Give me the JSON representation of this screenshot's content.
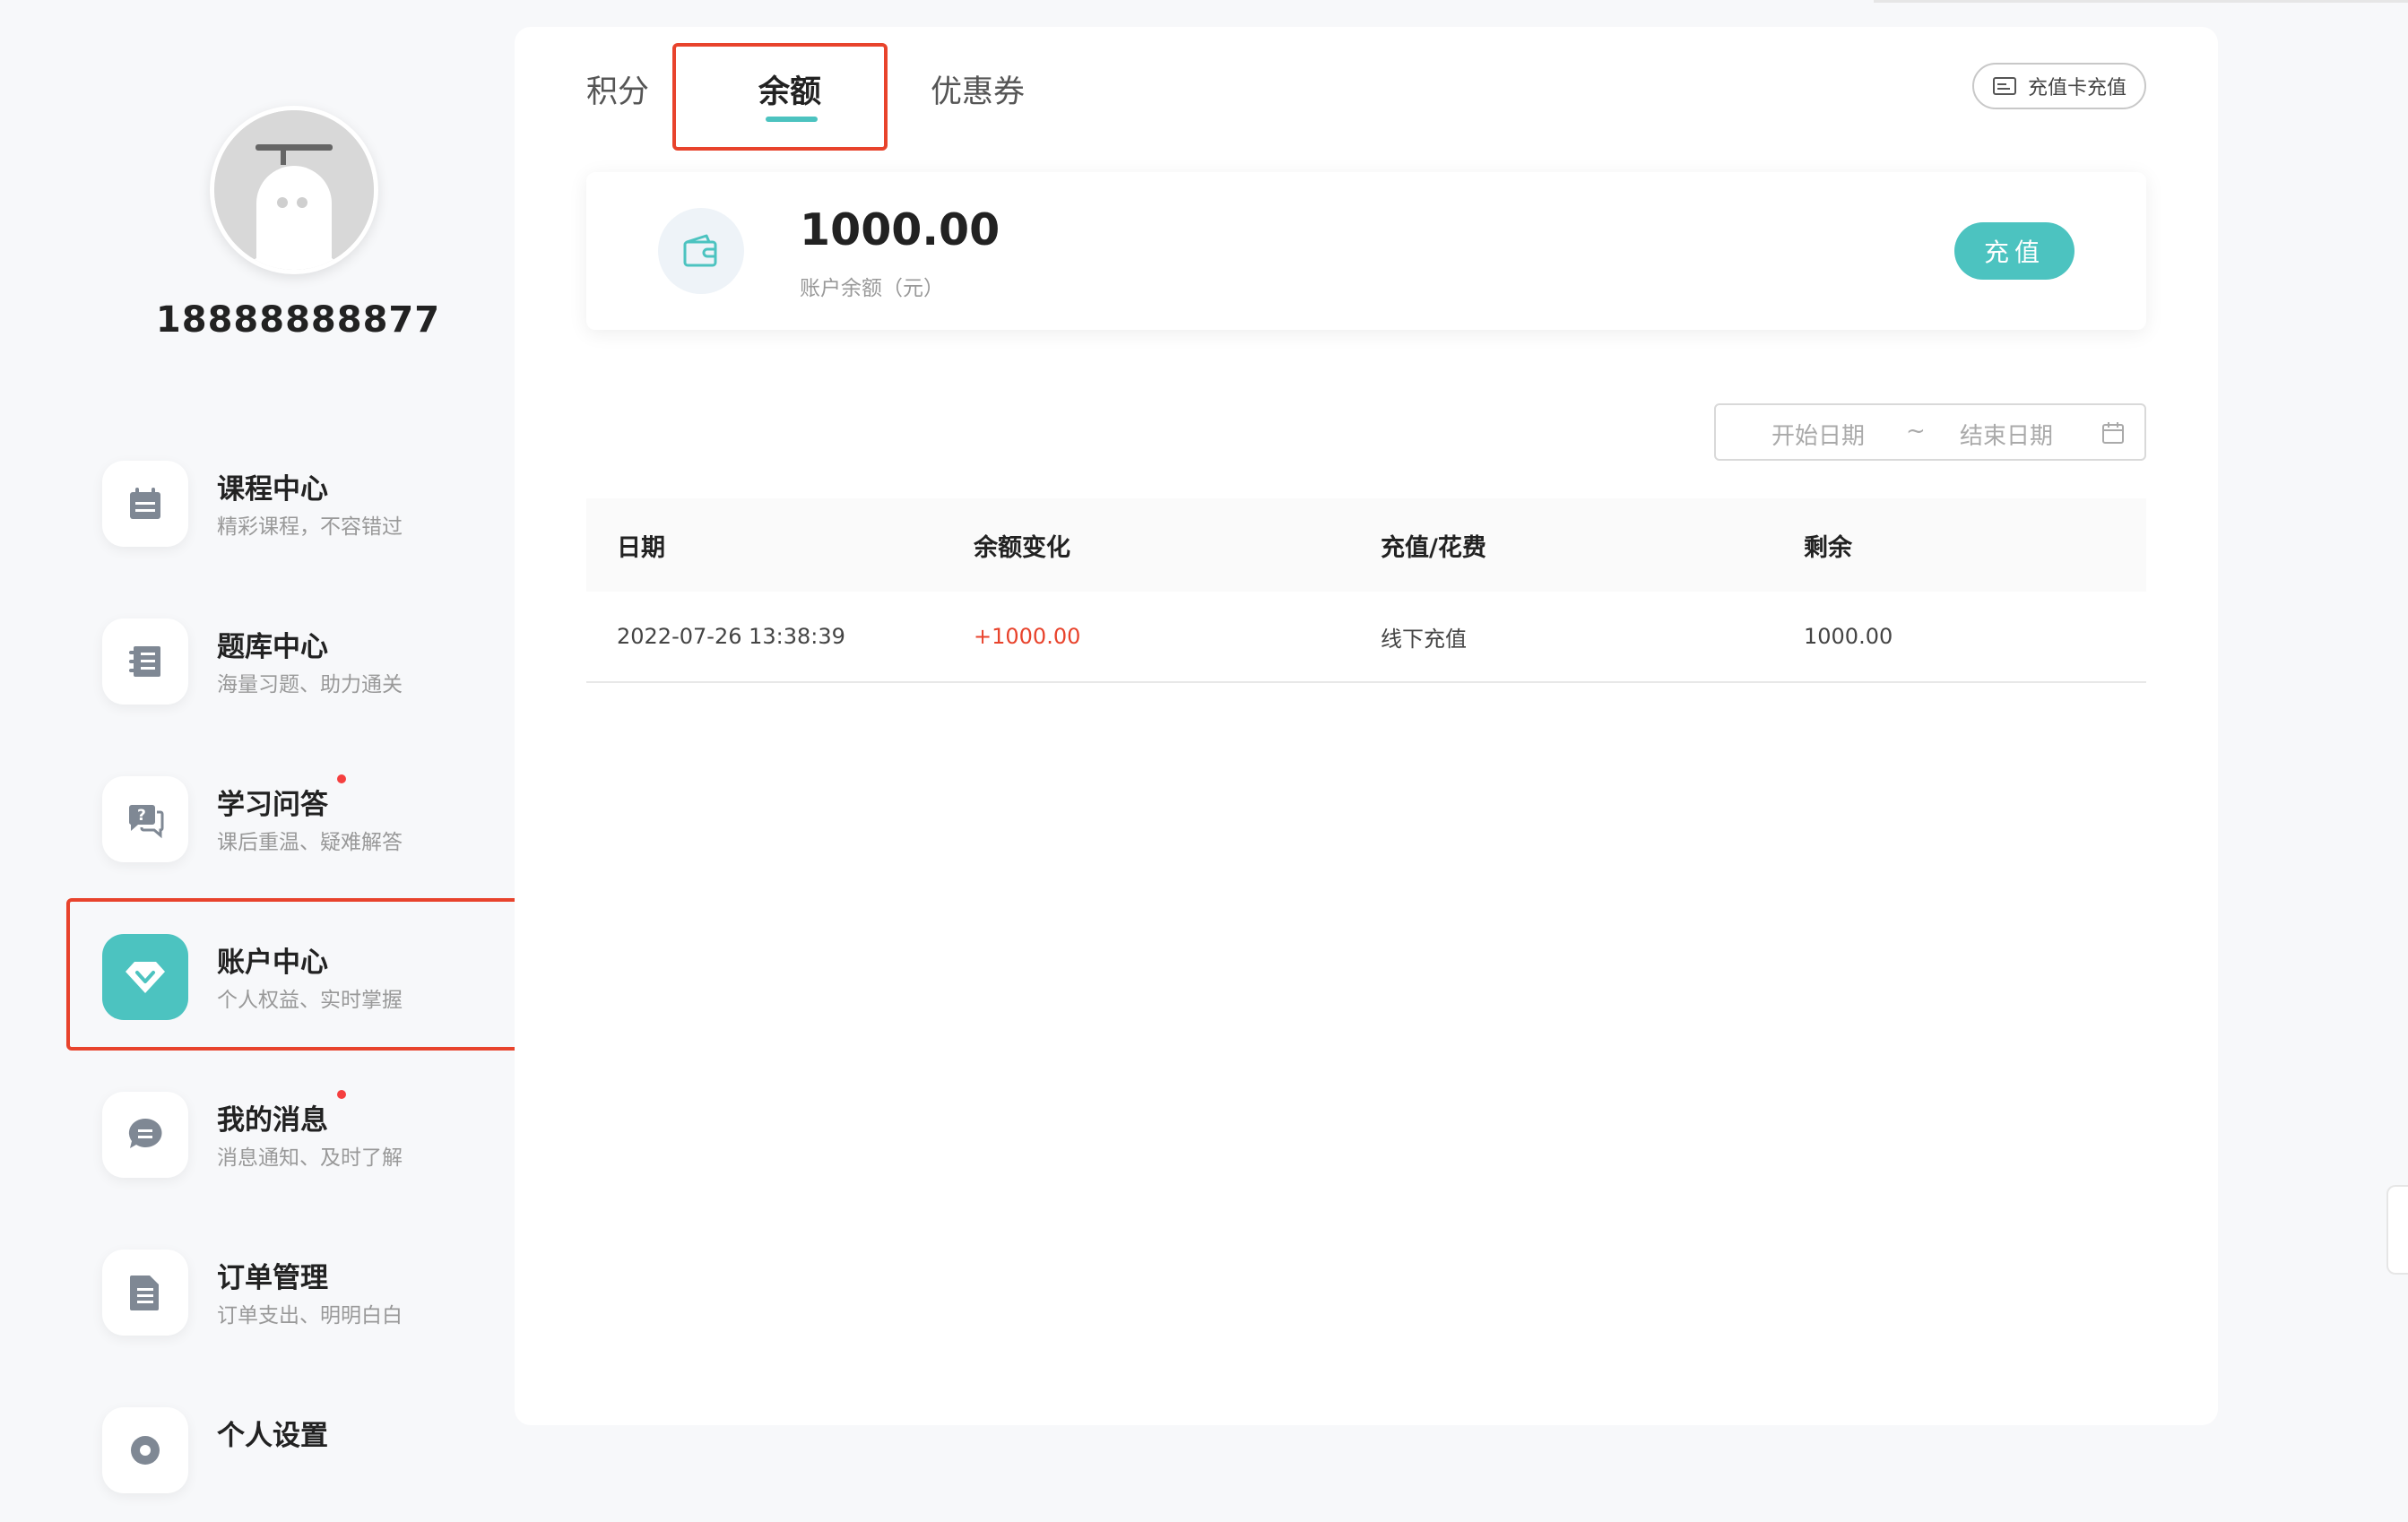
{
  "user": {
    "phone": "18888888877"
  },
  "sidebar": {
    "items": [
      {
        "id": "course",
        "title": "课程中心",
        "subtitle": "精彩课程，不容错过",
        "icon": "calendar-icon",
        "dot": false
      },
      {
        "id": "question-bank",
        "title": "题库中心",
        "subtitle": "海量习题、助力通关",
        "icon": "notebook-icon",
        "dot": false
      },
      {
        "id": "qa",
        "title": "学习问答",
        "subtitle": "课后重温、疑难解答",
        "icon": "question-chat-icon",
        "dot": true
      },
      {
        "id": "account",
        "title": "账户中心",
        "subtitle": "个人权益、实时掌握",
        "icon": "diamond-icon",
        "dot": false,
        "active": true
      },
      {
        "id": "messages",
        "title": "我的消息",
        "subtitle": "消息通知、及时了解",
        "icon": "message-icon",
        "dot": true
      },
      {
        "id": "orders",
        "title": "订单管理",
        "subtitle": "订单支出、明明白白",
        "icon": "document-icon",
        "dot": false
      },
      {
        "id": "settings",
        "title": "个人设置",
        "subtitle": "",
        "icon": "settings-icon",
        "dot": false
      }
    ]
  },
  "tabs": [
    {
      "label": "积分",
      "active": false
    },
    {
      "label": "余额",
      "active": true
    },
    {
      "label": "优惠券",
      "active": false
    }
  ],
  "card_recharge_label": "充值卡充值",
  "balance": {
    "amount": "1000.00",
    "label": "账户余额（元）",
    "recharge_label": "充值"
  },
  "date_filter": {
    "start_placeholder": "开始日期",
    "separator": "~",
    "end_placeholder": "结束日期"
  },
  "table": {
    "headers": [
      "日期",
      "余额变化",
      "充值/花费",
      "剩余"
    ],
    "rows": [
      {
        "date": "2022-07-26 13:38:39",
        "change": "+1000.00",
        "type": "线下充值",
        "remaining": "1000.00"
      }
    ]
  },
  "colors": {
    "accent": "#4cc3c0",
    "highlight": "#e8432c",
    "positive_change": "#e8432c",
    "dot": "#f53f3f"
  }
}
